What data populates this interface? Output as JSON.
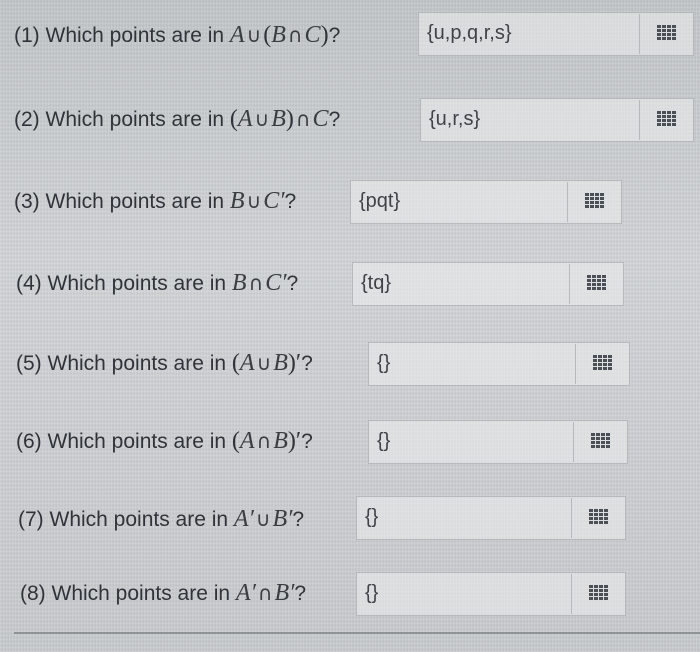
{
  "questions": [
    {
      "text": "(1) Which points are in ",
      "expr": [
        "A",
        "∪",
        "(",
        "B",
        "∩",
        "C",
        ")",
        "?"
      ],
      "answer": "{u,p,q,r,s}"
    },
    {
      "text": "(2) Which points are in ",
      "expr": [
        "(",
        "A",
        "∪",
        "B",
        ")",
        "∩",
        "C",
        "?"
      ],
      "answer": "{u,r,s}"
    },
    {
      "text": "(3) Which points are in ",
      "expr": [
        "B",
        "∪",
        "C′",
        "?"
      ],
      "answer": "{pqt}"
    },
    {
      "text": "(4) Which points are in ",
      "expr": [
        "B",
        "∩",
        "C′",
        "?"
      ],
      "answer": "{tq}"
    },
    {
      "text": "(5) Which points are in ",
      "expr": [
        "(",
        "A",
        "∪",
        "B",
        ")′",
        "?"
      ],
      "answer": "{}"
    },
    {
      "text": "(6) Which points are in ",
      "expr": [
        "(",
        "A",
        "∩",
        "B",
        ")′",
        "?"
      ],
      "answer": "{}"
    },
    {
      "text": "(7) Which points are in ",
      "expr": [
        "A′",
        "∪",
        "B′",
        "?"
      ],
      "answer": "{}"
    },
    {
      "text": "(8) Which points are in ",
      "expr": [
        "A′",
        "∩",
        "B′",
        "?"
      ],
      "answer": "{}"
    }
  ],
  "keypad_icon": "keypad-grid-icon",
  "colors": {
    "text": "#30343a",
    "box_border": "#969ba0",
    "icon": "#4b5056"
  }
}
